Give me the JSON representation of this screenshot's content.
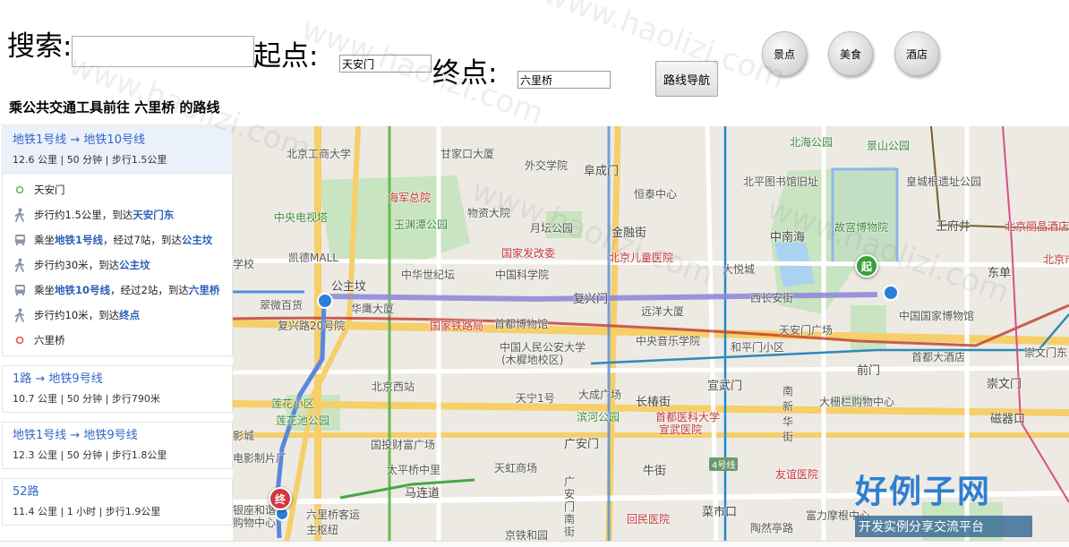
{
  "search": {
    "label": "搜索:",
    "value": ""
  },
  "start": {
    "label": "起点:",
    "value": "天安门"
  },
  "end": {
    "label": "终点:",
    "value": "六里桥"
  },
  "nav_button": "路线导航",
  "categories": [
    "景点",
    "美食",
    "酒店"
  ],
  "route_title": "乘公共交通工具前往 六里桥 的路线",
  "plans": [
    {
      "name": "地铁1号线 → 地铁10号线",
      "meta": "12.6 公里 | 50 分钟 | 步行1.5公里"
    },
    {
      "name": "1路 → 地铁9号线",
      "meta": "10.7 公里 | 50 分钟 | 步行790米"
    },
    {
      "name": "地铁1号线 → 地铁9号线",
      "meta": "12.3 公里 | 50 分钟 | 步行1.8公里"
    },
    {
      "name": "52路",
      "meta": "11.4 公里 | 1 小时 | 步行1.9公里"
    }
  ],
  "steps": [
    {
      "pre": "天安门",
      "hl": "",
      "post": "",
      "hl2": ""
    },
    {
      "pre": "步行约1.5公里，到达",
      "hl": "天安门东",
      "post": "",
      "hl2": ""
    },
    {
      "pre": "乘坐",
      "hl": "地铁1号线",
      "post": "，经过7站，到达",
      "hl2": "公主坟"
    },
    {
      "pre": "步行约30米，到达",
      "hl": "公主坟",
      "post": "",
      "hl2": ""
    },
    {
      "pre": "乘坐",
      "hl": "地铁10号线",
      "post": "，经过2站，到达",
      "hl2": "六里桥"
    },
    {
      "pre": "步行约10米，到达",
      "hl": "终点",
      "post": "",
      "hl2": ""
    },
    {
      "pre": "六里桥",
      "hl": "",
      "post": "",
      "hl2": ""
    }
  ],
  "map": {
    "start_pin": "起",
    "end_pin": "终",
    "line_label": "4号线",
    "labels": {
      "l1": "北京工商大学",
      "l2": "甘家口大厦",
      "l3": "外交学院",
      "l4": "阜成门",
      "l5": "北海公园",
      "l6": "景山公园",
      "l7": "海军总院",
      "l8": "恒泰中心",
      "l9": "北平图书馆旧址",
      "l10": "皇城根遗址公园",
      "l11": "中央电视塔",
      "l12": "玉渊潭公园",
      "l13": "物资大院",
      "l14": "月坛公园",
      "l15": "金融街",
      "l16": "中南海",
      "l17": "故宫博物院",
      "l18": "王府井",
      "l19": "北京丽晶酒店",
      "l20": "凯德MALL",
      "l21": "国家发改委",
      "l22": "北京儿童医院",
      "l23": "大悦城",
      "l24": "中华世纪坛",
      "l25": "中国科学院",
      "l26": "东单",
      "l27": "北京市民检察",
      "l28": "公主坟",
      "l29": "复兴门",
      "l30": "西长安街",
      "l31": "翠微百货",
      "l32": "华鹰大厦",
      "l33": "国家铁路局",
      "l34": "首都博物馆",
      "l35": "远洋大厦",
      "l36": "中国国家博物馆",
      "l37": "复兴路20号院",
      "l38": "中国人民公安大学",
      "l39": "(木樨地校区)",
      "l40": "中央音乐学院",
      "l41": "和平门小区",
      "l42": "天安门广场",
      "l43": "首都大酒店",
      "l44": "前门",
      "l45": "崇文门东",
      "l46": "北京西站",
      "l47": "天宁1号",
      "l48": "大成广场",
      "l49": "长椿街",
      "l50": "宣武门",
      "l51": "大栅栏购物中心",
      "l52": "崇文门",
      "l53": "莲花小区",
      "l54": "莲花池公园",
      "l55": "滨河公园",
      "l56": "首都医科大学",
      "l57": "宣武医院",
      "l58": "磁器口",
      "l59": "国投财富广场",
      "l60": "广安门",
      "l61": "南新华街",
      "l62": "影城",
      "l63": "电影制片厂",
      "l64": "太平桥中里",
      "l65": "天虹商场",
      "l66": "牛街",
      "l67": "友谊医院",
      "l68": "马连道",
      "l69": "广安门南街",
      "l70": "六里桥客运主枢纽",
      "l71": "回民医院",
      "l72": "菜市口",
      "l73": "富力摩根中心",
      "l74": "陶然亭路",
      "l75": "京铁和园",
      "l76": "银座和谐",
      "l77": "购物中心",
      "l78": "学校"
    }
  },
  "brand": {
    "title": "好例子网",
    "subtitle": "开发实例分享交流平台"
  },
  "watermark": "www.haolizi.com"
}
